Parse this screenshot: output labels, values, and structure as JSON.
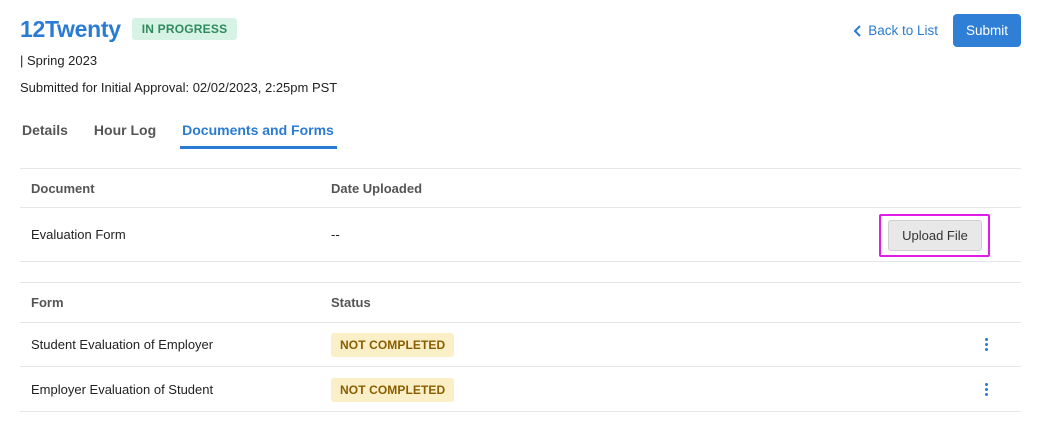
{
  "header": {
    "app_title": "12Twenty",
    "status": "IN PROGRESS",
    "term": "| Spring 2023",
    "submitted": "Submitted for Initial Approval: 02/02/2023, 2:25pm PST",
    "back_label": "Back to List",
    "submit_label": "Submit"
  },
  "tabs": [
    {
      "label": "Details"
    },
    {
      "label": "Hour Log"
    },
    {
      "label": "Documents and Forms"
    }
  ],
  "documents": {
    "headers": [
      "Document",
      "Date Uploaded"
    ],
    "rows": [
      {
        "name": "Evaluation Form",
        "date": "--",
        "action": "Upload File"
      }
    ]
  },
  "forms": {
    "headers": [
      "Form",
      "Status"
    ],
    "rows": [
      {
        "name": "Student Evaluation of Employer",
        "status": "NOT COMPLETED"
      },
      {
        "name": "Employer Evaluation of Student",
        "status": "NOT COMPLETED"
      }
    ]
  },
  "colors": {
    "accent": "#2a7bd4",
    "status_green_bg": "#d7f3e6",
    "warning_bg": "#fbefc8",
    "highlight": "#e11ee8"
  }
}
